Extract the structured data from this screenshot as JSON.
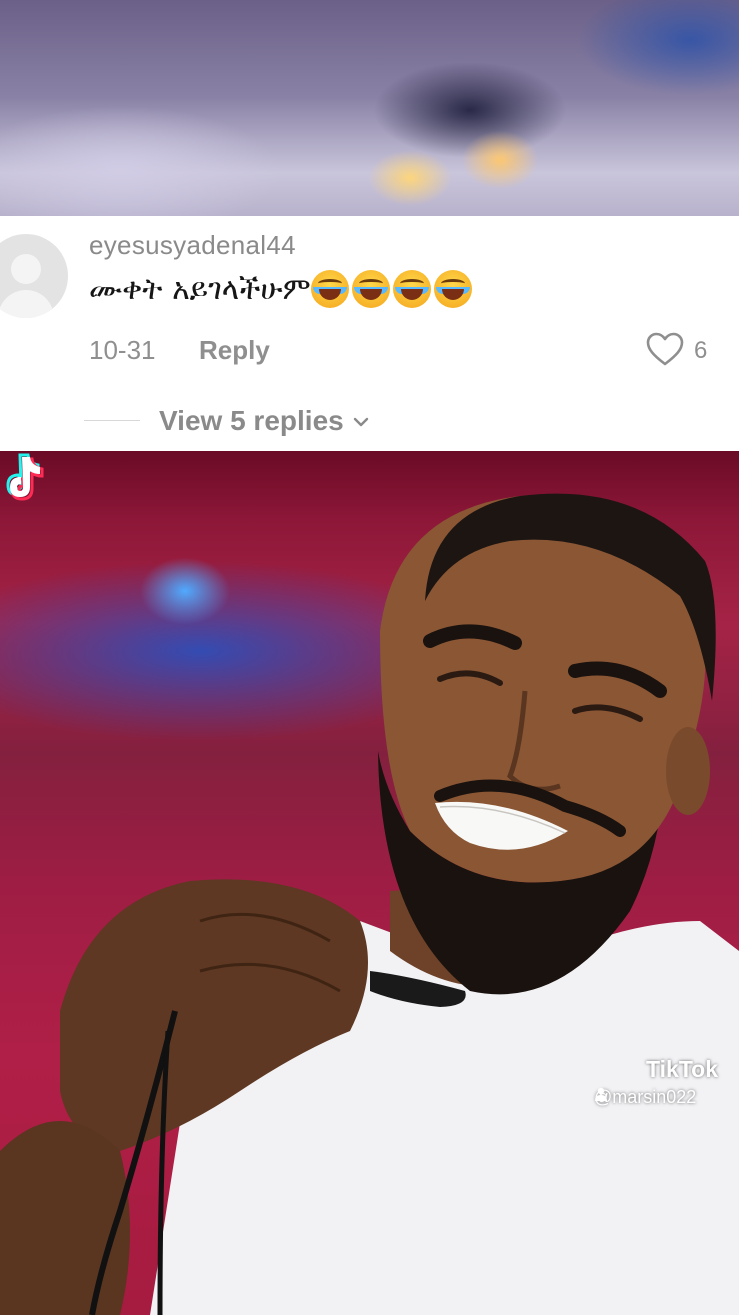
{
  "comment": {
    "username": "eyesusyadenal44",
    "text": "ሙቀት አይገላችሁም",
    "emoji": [
      "face-with-tears-of-joy",
      "face-with-tears-of-joy",
      "face-with-tears-of-joy",
      "face-with-tears-of-joy"
    ],
    "date": "10-31",
    "reply_label": "Reply",
    "like_count": "6",
    "view_replies_label": "View 5 replies"
  },
  "watermark": {
    "brand": "TikTok",
    "handle": "@marsin022"
  },
  "colors": {
    "username": "#8a8a8a",
    "meta": "#8f8f8f",
    "video_background": "#a52346",
    "tiktok_cyan": "#25f4ee",
    "tiktok_red": "#fe2c55"
  }
}
